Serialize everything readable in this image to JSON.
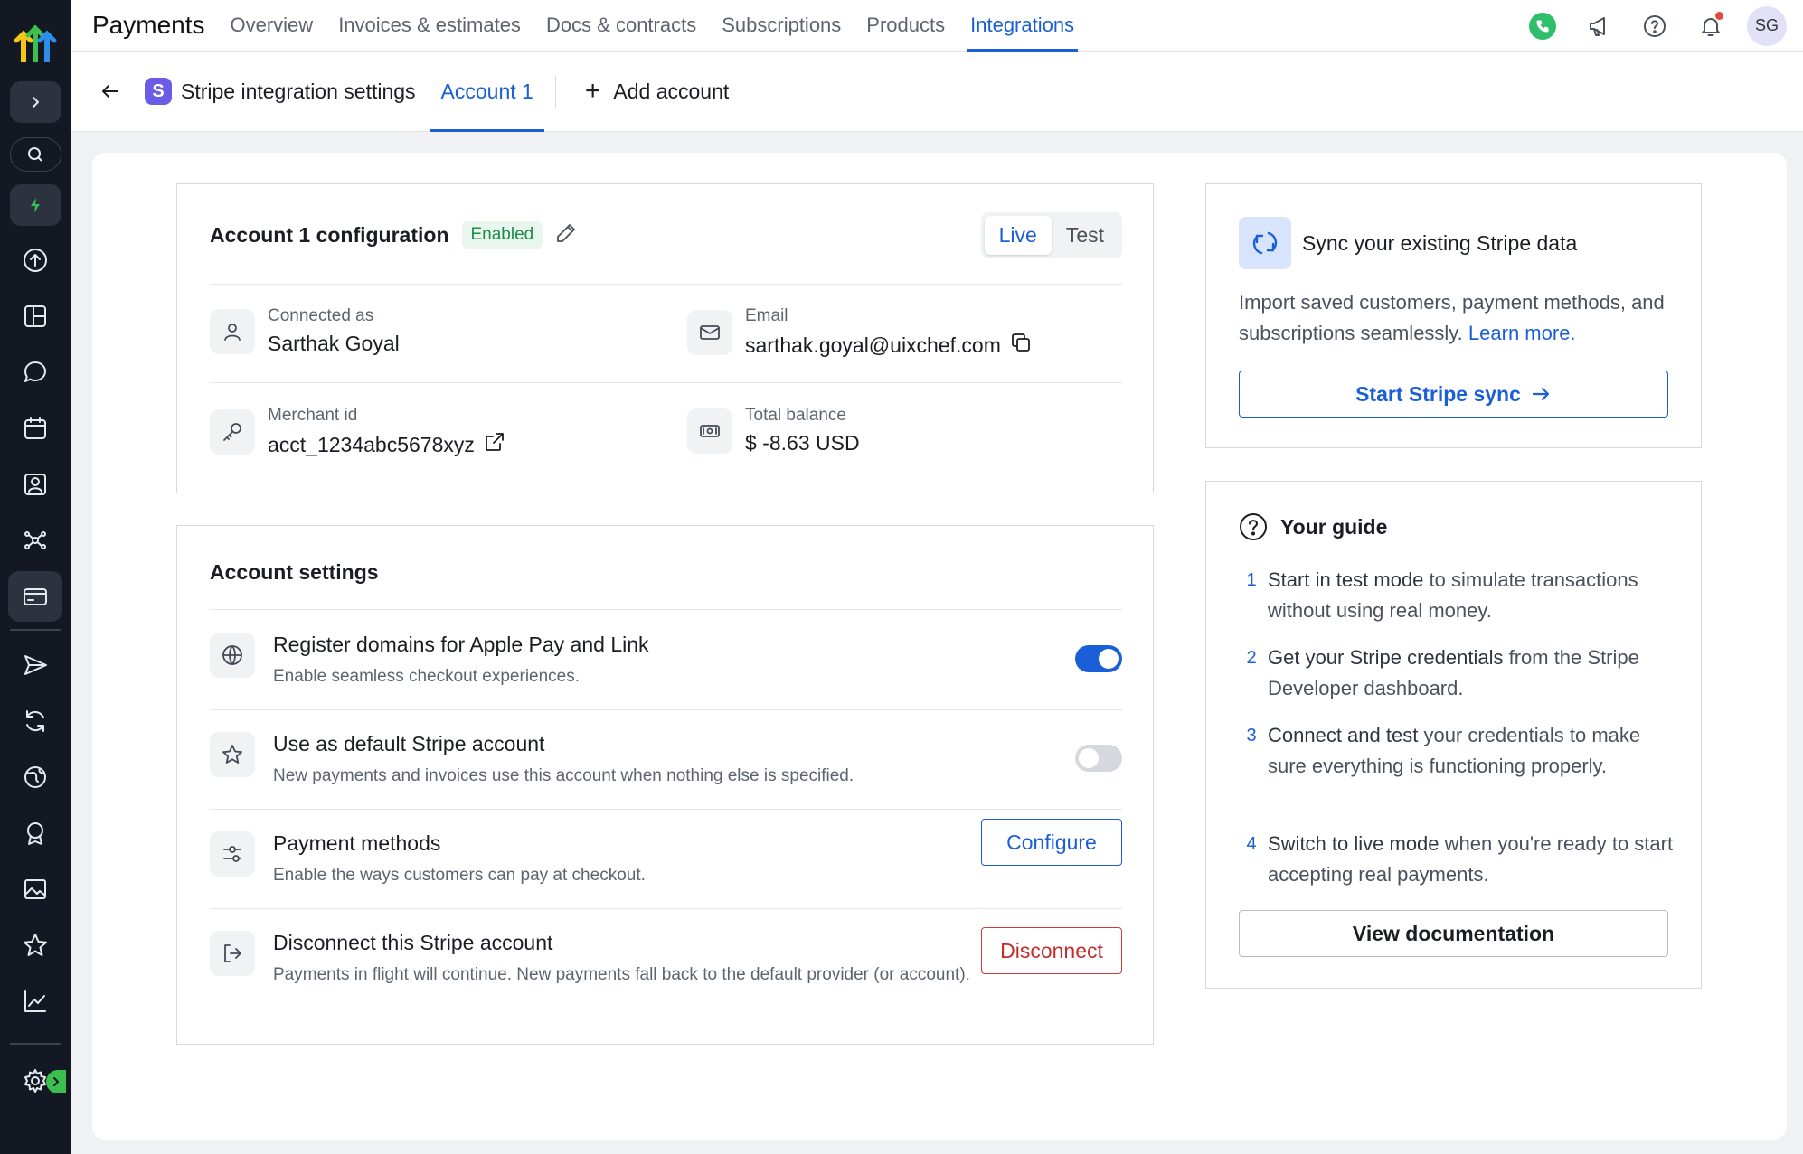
{
  "app": {
    "title": "Payments"
  },
  "nav": {
    "tabs": [
      {
        "label": "Overview"
      },
      {
        "label": "Invoices & estimates"
      },
      {
        "label": "Docs & contracts"
      },
      {
        "label": "Subscriptions"
      },
      {
        "label": "Products"
      },
      {
        "label": "Integrations"
      }
    ],
    "active": "Integrations",
    "avatar_initials": "SG"
  },
  "subheader": {
    "stripe_letter": "S",
    "title": "Stripe integration settings",
    "active_tab": "Account 1",
    "add_account": "Add account"
  },
  "config": {
    "title": "Account 1 configuration",
    "status": "Enabled",
    "modes": [
      "Live",
      "Test"
    ],
    "active_mode": "Live",
    "connected_as_label": "Connected as",
    "connected_as_value": "Sarthak Goyal",
    "email_label": "Email",
    "email_value": "sarthak.goyal@uixchef.com",
    "merchant_label": "Merchant id",
    "merchant_value": "acct_1234abc5678xyz",
    "balance_label": "Total balance",
    "balance_value": "$ -8.63 USD"
  },
  "settings": {
    "title": "Account settings",
    "rows": [
      {
        "title": "Register domains for Apple Pay and Link",
        "desc": "Enable seamless checkout experiences.",
        "toggle": true
      },
      {
        "title": "Use as default Stripe account",
        "desc": "New payments and invoices use this account when nothing else is specified.",
        "toggle": false
      },
      {
        "title": "Payment methods",
        "desc": "Enable the ways customers can pay at checkout.",
        "action": "Configure"
      },
      {
        "title": "Disconnect this Stripe account",
        "desc": "Payments in flight will continue. New payments fall back to the default provider (or account).",
        "action": "Disconnect"
      }
    ]
  },
  "sync": {
    "title": "Sync your existing Stripe data",
    "desc": "Import saved customers, payment methods, and subscriptions seamlessly.",
    "link": "Learn more.",
    "button": "Start Stripe sync"
  },
  "guide": {
    "title": "Your guide",
    "steps": [
      {
        "num": "1",
        "bold": "Start in test mode",
        "rest": " to simulate transactions without using real money."
      },
      {
        "num": "2",
        "bold": "Get your Stripe credentials",
        "rest": " from the Stripe Developer dashboard."
      },
      {
        "num": "3",
        "bold": "Connect and test",
        "rest": " your credentials to make sure everything is functioning properly."
      },
      {
        "num": "4",
        "bold": "Switch to live mode",
        "rest": " when you're ready to start accepting real payments."
      }
    ],
    "button": "View documentation"
  },
  "colors": {
    "accent": "#1a5ed8",
    "sidebar": "#131822",
    "success": "#1e8a4c",
    "danger": "#c22d2d"
  }
}
